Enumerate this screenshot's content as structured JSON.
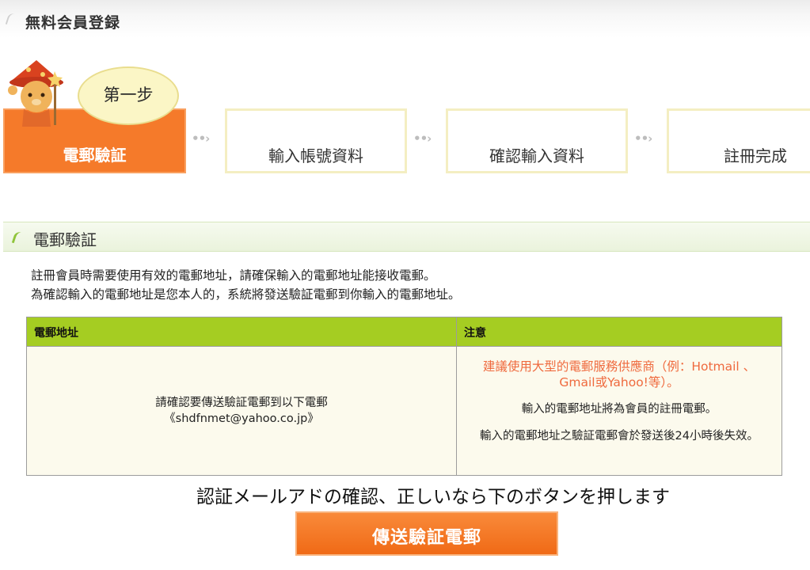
{
  "header": {
    "title": "無料会員登録"
  },
  "steps": {
    "bubble": "第一步",
    "items": [
      {
        "label": "電郵驗証"
      },
      {
        "label": "輸入帳號資料"
      },
      {
        "label": "確認輸入資料"
      },
      {
        "label": "註冊完成"
      }
    ]
  },
  "section": {
    "title": "電郵驗証"
  },
  "intro": {
    "line1": "註冊會員時需要使用有效的電郵地址，請確保輸入的電郵地址能接收電郵。",
    "line2": "為確認輸入的電郵地址是您本人的，系統將發送驗証電郵到你輸入的電郵地址。"
  },
  "table": {
    "col1": "電郵地址",
    "col2": "注意",
    "confirm_line1": "請確認要傳送驗証電郵到以下電郵",
    "confirm_email": "《shdfnmet@yahoo.co.jp》",
    "notes": [
      "建議使用大型的電郵服務供應商（例：Hotmail 、 Gmail或Yahoo!等）。",
      "輸入的電郵地址將為會員的註冊電郵。",
      "輸入的電郵地址之驗証電郵會於發送後24小時後失效。"
    ]
  },
  "instruction": "認証メールアドの確認、正しいなら下のボタンを押します",
  "button": {
    "label": "傳送驗証電郵"
  },
  "colors": {
    "accent": "#f57a2a",
    "table_header": "#a5cd22",
    "warning": "#ef6a3e"
  }
}
